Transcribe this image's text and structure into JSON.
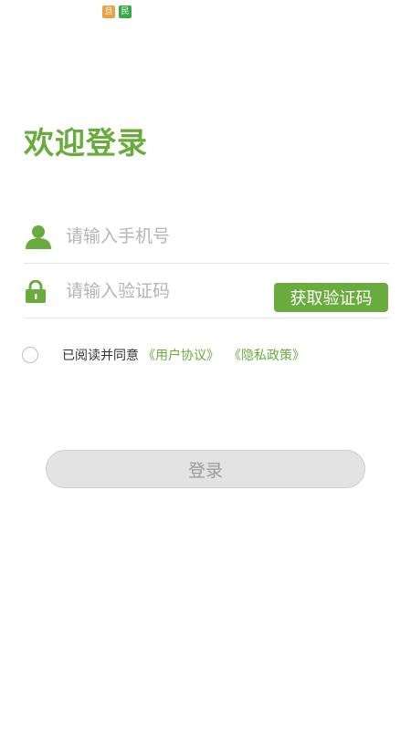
{
  "status_bar": {
    "icons": [
      {
        "name": "orange-app-icon",
        "glyph": "旦",
        "color": "#e8a34a"
      },
      {
        "name": "green-app-icon",
        "glyph": "民",
        "color": "#3aa946"
      }
    ]
  },
  "page": {
    "title": "欢迎登录"
  },
  "form": {
    "phone": {
      "placeholder": "请输入手机号",
      "value": "",
      "icon": "user-icon"
    },
    "code": {
      "placeholder": "请输入验证码",
      "value": "",
      "icon": "lock-icon"
    },
    "get_code_label": "获取验证码"
  },
  "agreement": {
    "checked": false,
    "text": "已阅读并同意",
    "user_agreement": "《用户协议》",
    "privacy_policy": "《隐私政策》"
  },
  "login": {
    "label": "登录",
    "enabled": false
  },
  "colors": {
    "accent": "#6aab3d",
    "disabled_button": "#e3e3e3",
    "placeholder": "#b5b5b5"
  }
}
